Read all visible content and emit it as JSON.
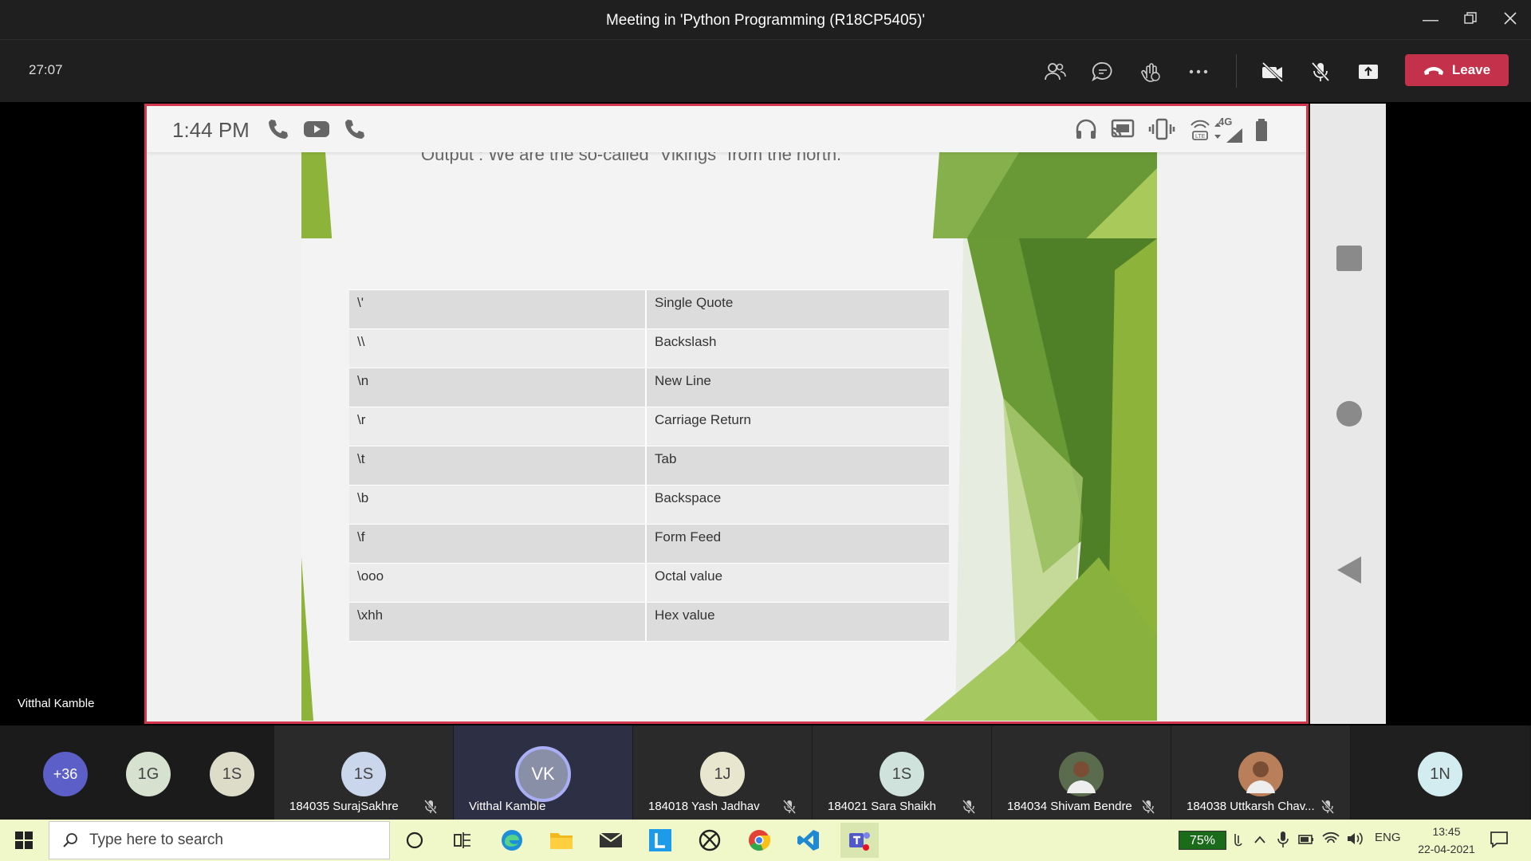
{
  "window": {
    "title": "Meeting in 'Python Programming (R18CP5405)'"
  },
  "toolbar": {
    "timer": "27:07",
    "leave_label": "Leave"
  },
  "phone_status": {
    "time": "1:44 PM",
    "network": "4G"
  },
  "slide": {
    "cut_text": "Output : We are the so-called \"Vikings\" from the north.",
    "escape_table": [
      {
        "code": "\\'",
        "meaning": "Single Quote"
      },
      {
        "code": "\\\\",
        "meaning": "Backslash"
      },
      {
        "code": "\\n",
        "meaning": "New Line"
      },
      {
        "code": "\\r",
        "meaning": "Carriage Return"
      },
      {
        "code": "\\t",
        "meaning": "Tab"
      },
      {
        "code": "\\b",
        "meaning": "Backspace"
      },
      {
        "code": "\\f",
        "meaning": "Form Feed"
      },
      {
        "code": "\\ooo",
        "meaning": "Octal value"
      },
      {
        "code": "\\xhh",
        "meaning": "Hex value"
      }
    ]
  },
  "presenter": "Vitthal Kamble",
  "participants": {
    "overflow": "+36",
    "small": [
      "1G",
      "1S"
    ],
    "tiles": [
      {
        "initials": "1S",
        "name": "184035 SurajSakhre",
        "muted": true,
        "color": "#c9d6ec"
      },
      {
        "initials": "VK",
        "name": "Vitthal Kamble",
        "muted": false,
        "color": "#8a8fa8",
        "active": true
      },
      {
        "initials": "1J",
        "name": "184018 Yash Jadhav",
        "muted": true,
        "color": "#e8e6cf"
      },
      {
        "initials": "1S",
        "name": "184021 Sara Shaikh",
        "muted": true,
        "color": "#cfe3dc"
      },
      {
        "initials": "",
        "name": "184034 Shivam Bendre",
        "muted": true,
        "color": "#5b6b4e",
        "photo": true
      },
      {
        "initials": "",
        "name": "184038 Uttkarsh Chav...",
        "muted": true,
        "color": "#b97e5a",
        "photo": true
      },
      {
        "initials": "1N",
        "name": "",
        "muted": false,
        "color": "#d3ecf0"
      }
    ]
  },
  "taskbar": {
    "search_placeholder": "Type here to search",
    "battery": "75%",
    "language": "ENG",
    "time": "13:45",
    "date": "22-04-2021"
  }
}
